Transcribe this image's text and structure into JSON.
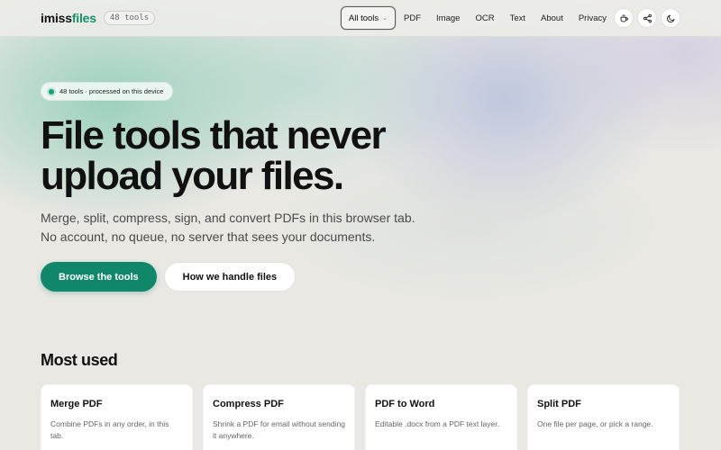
{
  "header": {
    "logo_part1": "imiss",
    "logo_part2": "files",
    "tool_count_badge": "48 tools",
    "nav": {
      "all_tools": "All tools",
      "links": [
        "PDF",
        "Image",
        "OCR",
        "Text",
        "About",
        "Privacy"
      ]
    },
    "icons": [
      "coffee-icon",
      "share-icon",
      "moon-icon"
    ]
  },
  "hero": {
    "pill_text": "48 tools · processed on this device",
    "headline_line1": "File tools that never",
    "headline_line2": "upload your files.",
    "subline": "Merge, split, compress, sign, and convert PDFs in this browser tab. No account, no queue, no server that sees your documents.",
    "primary_cta": "Browse the tools",
    "secondary_cta": "How we handle files"
  },
  "most_used": {
    "title": "Most used",
    "cards": [
      {
        "title": "Merge PDF",
        "desc": "Combine PDFs in any order, in this tab."
      },
      {
        "title": "Compress PDF",
        "desc": "Shrink a PDF for email without sending it anywhere."
      },
      {
        "title": "PDF to Word",
        "desc": "Editable .docx from a PDF text layer."
      },
      {
        "title": "Split PDF",
        "desc": "One file per page, or pick a range."
      }
    ]
  },
  "colors": {
    "accent": "#11876a",
    "logo_accent": "#13926d",
    "background": "#e9e8e3"
  }
}
